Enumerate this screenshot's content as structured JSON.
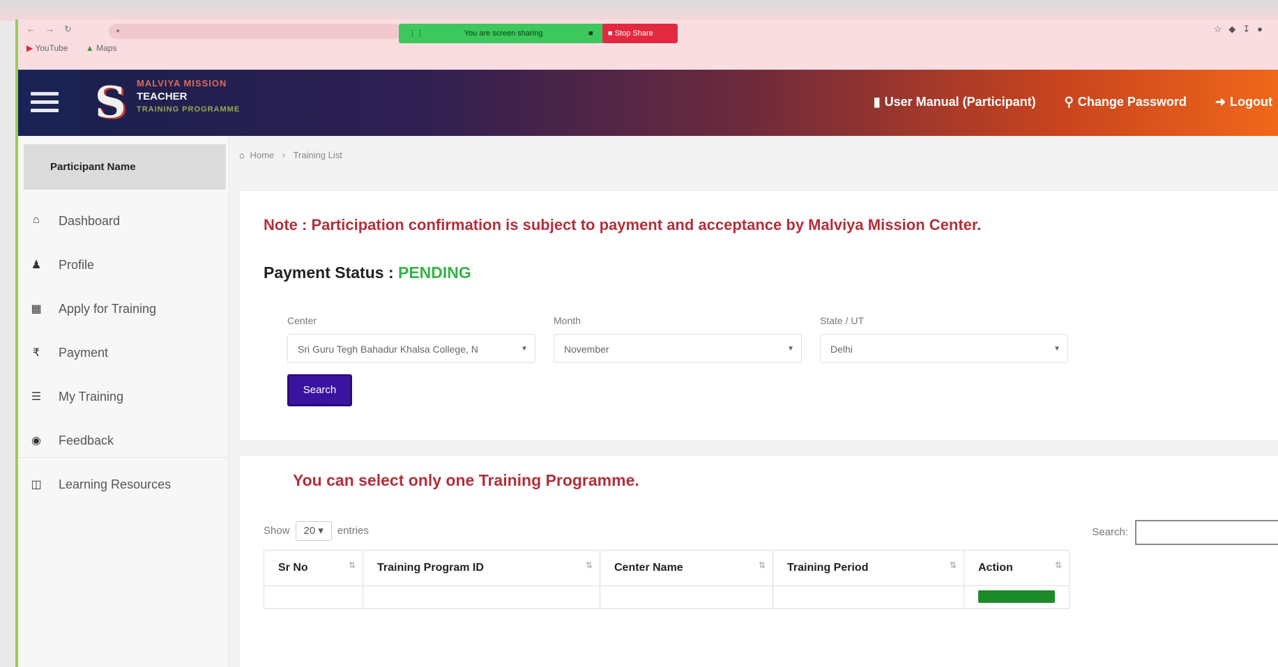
{
  "browser": {
    "url": "",
    "bookmarks": [
      {
        "label": "YouTube",
        "icon": "youtube-icon"
      },
      {
        "label": "Maps",
        "icon": "maps-icon"
      }
    ],
    "share_bar_text": "You are screen sharing",
    "hide_label": "Stop Share"
  },
  "header": {
    "logo": {
      "line1": "MALVIYA MISSION",
      "line2": "TEACHER",
      "line3": "TRAINING PROGRAMME"
    },
    "links": [
      {
        "label": "User Manual (Participant)",
        "icon": "book-icon"
      },
      {
        "label": "Change Password",
        "icon": "key-icon"
      },
      {
        "label": "Logout",
        "icon": "logout-icon"
      }
    ]
  },
  "sidebar": {
    "participant_name": "Participant Name",
    "items": [
      {
        "label": "Dashboard",
        "icon": "home-icon"
      },
      {
        "label": "Profile",
        "icon": "user-icon"
      },
      {
        "label": "Apply for Training",
        "icon": "calendar-icon"
      },
      {
        "label": "Payment",
        "icon": "rupee-icon"
      },
      {
        "label": "My Training",
        "icon": "list-icon"
      },
      {
        "label": "Feedback",
        "icon": "feedback-icon"
      },
      {
        "label": "Learning Resources",
        "icon": "book-icon"
      }
    ]
  },
  "breadcrumb": {
    "home": "Home",
    "current": "Training List"
  },
  "notice": {
    "note": "Note : Participation confirmation is subject to payment and acceptance by Malviya Mission Center.",
    "payment_status_label": "Payment Status : ",
    "payment_status_value": "PENDING"
  },
  "filters": {
    "center": {
      "label": "Center",
      "value": "Sri Guru Tegh Bahadur Khalsa College, N"
    },
    "month": {
      "label": "Month",
      "value": "November"
    },
    "state": {
      "label": "State / UT",
      "value": "Delhi"
    },
    "search_button": "Search"
  },
  "training": {
    "select_note": "You can select only one Training Programme.",
    "show_label": "Show",
    "entries_value": "20",
    "entries_label": "entries",
    "search_label": "Search:",
    "columns": [
      "Sr No",
      "Training Program ID",
      "Center Name",
      "Training Period",
      "Action"
    ]
  },
  "colors": {
    "accent": "#3a14a0",
    "note_red": "#b2303a",
    "pending_green": "#35b34a",
    "header_start": "#18204d",
    "header_end": "#f0681a"
  }
}
